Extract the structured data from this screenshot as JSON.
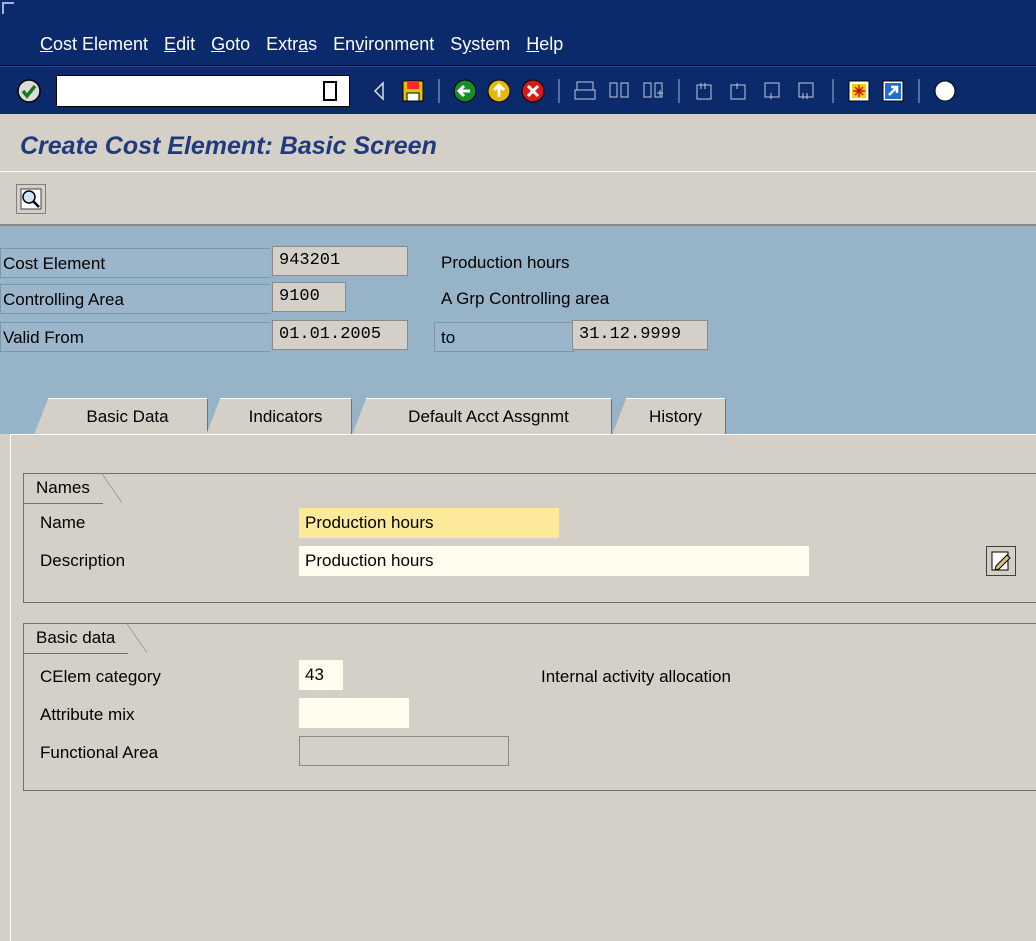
{
  "menu": [
    {
      "label": "Cost Element",
      "key": "C",
      "rest": "ost Element"
    },
    {
      "label": "Edit",
      "key": "E",
      "rest": "dit"
    },
    {
      "label": "Goto",
      "key": "G",
      "rest": "oto"
    },
    {
      "label": "Extras",
      "pre": "Extr",
      "key": "a",
      "rest": "s"
    },
    {
      "label": "Environment",
      "pre": "En",
      "key": "v",
      "rest": "ironment"
    },
    {
      "label": "System",
      "pre": "S",
      "key": "y",
      "rest": "stem"
    },
    {
      "label": "Help",
      "key": "H",
      "rest": "elp"
    }
  ],
  "toolbar": {
    "command_value": "",
    "icons": [
      "enter-icon",
      "save-icon",
      "back-icon",
      "exit-icon",
      "cancel-icon",
      "print-icon",
      "find-icon",
      "find-next-icon",
      "first-page-icon",
      "previous-page-icon",
      "next-page-icon",
      "last-page-icon",
      "create-session-icon",
      "shortcut-icon"
    ]
  },
  "title": "Create Cost Element: Basic Screen",
  "header": {
    "cost_element_label": "Cost Element",
    "cost_element_value": "943201",
    "cost_element_text": "Production hours",
    "controlling_area_label": "Controlling Area",
    "controlling_area_value": "9100",
    "controlling_area_text": "A Grp Controlling area",
    "valid_from_label": "Valid From",
    "valid_from_value": "01.01.2005",
    "to_label": "to",
    "valid_to_value": "31.12.9999"
  },
  "tabs": [
    {
      "label": "Basic Data",
      "active": true
    },
    {
      "label": "Indicators",
      "active": false
    },
    {
      "label": "Default Acct Assgnmt",
      "active": false
    },
    {
      "label": "History",
      "active": false
    }
  ],
  "names_group": {
    "title": "Names",
    "name_label": "Name",
    "name_value": "Production hours",
    "description_label": "Description",
    "description_value": "Production hours"
  },
  "basic_data_group": {
    "title": "Basic data",
    "celem_category_label": "CElem category",
    "celem_category_value": "43",
    "celem_category_text": "Internal activity allocation",
    "attribute_mix_label": "Attribute mix",
    "attribute_mix_value": "",
    "functional_area_label": "Functional Area",
    "functional_area_value": ""
  },
  "colors": {
    "menubar": "#0b2a6b",
    "title": "#213b7a",
    "header_bg": "#97b3c8",
    "panel_bg": "#d4d0c8",
    "required_field": "#fce99a"
  }
}
